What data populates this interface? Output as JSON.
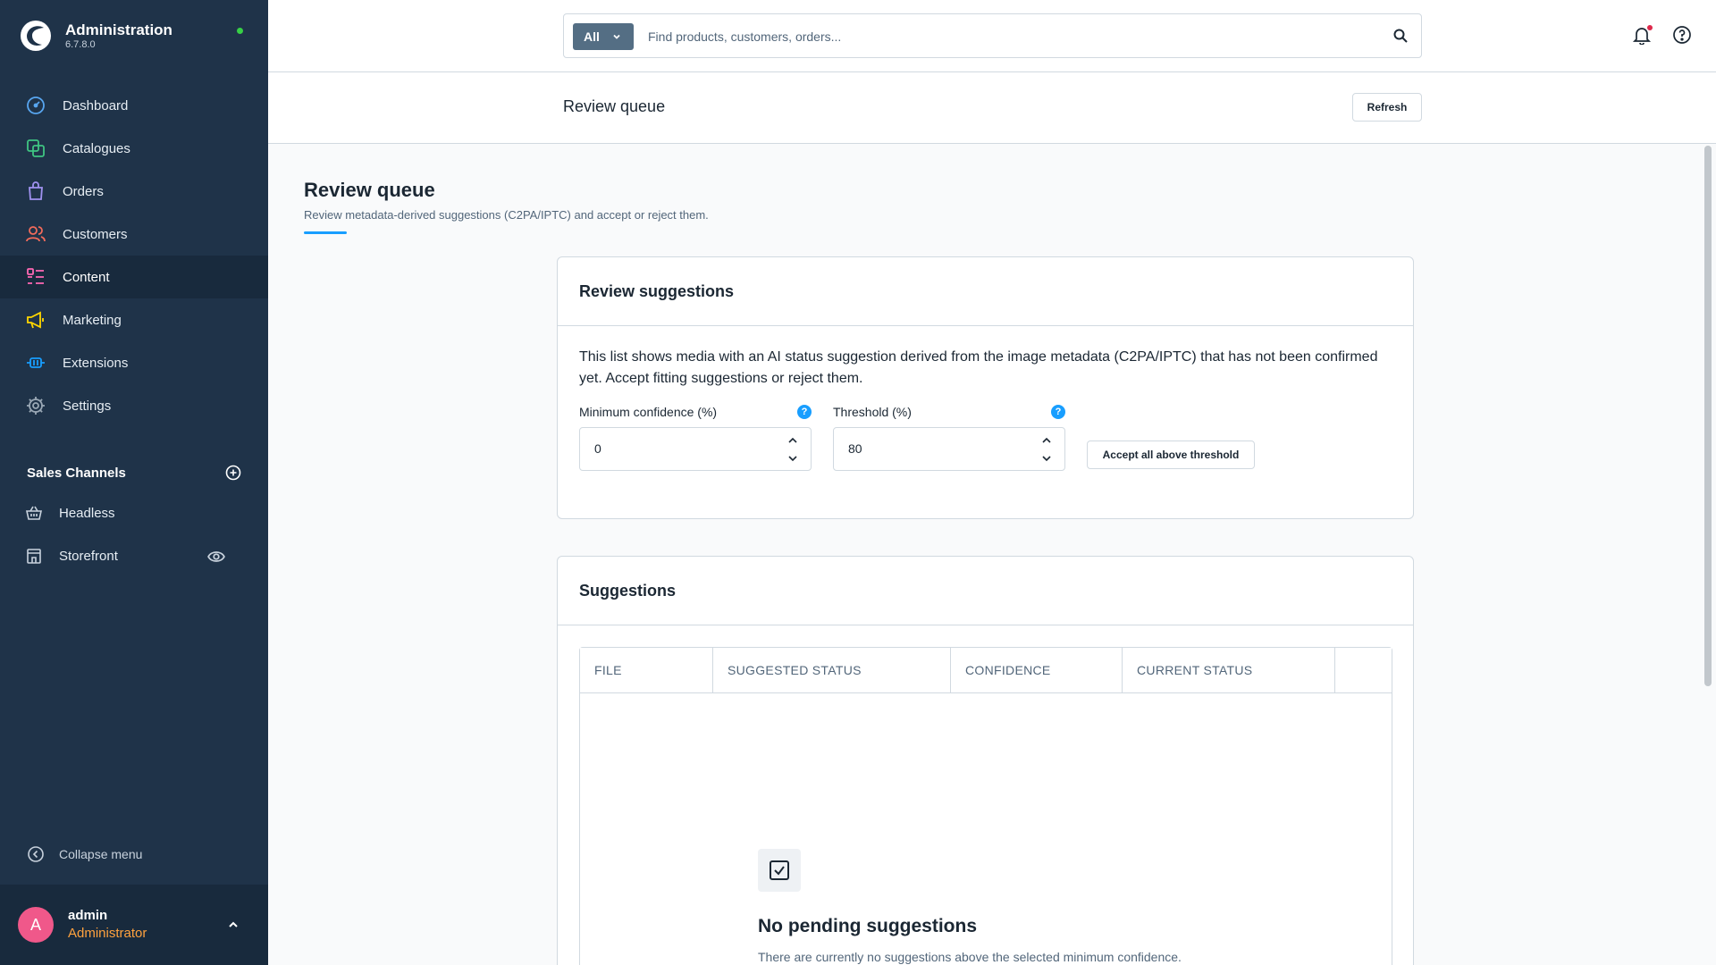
{
  "app": {
    "title": "Administration",
    "version": "6.7.8.0"
  },
  "nav": [
    {
      "label": "Dashboard",
      "icon": "dashboard-icon"
    },
    {
      "label": "Catalogues",
      "icon": "catalogues-icon"
    },
    {
      "label": "Orders",
      "icon": "orders-icon"
    },
    {
      "label": "Customers",
      "icon": "customers-icon"
    },
    {
      "label": "Content",
      "icon": "content-icon",
      "active": true
    },
    {
      "label": "Marketing",
      "icon": "marketing-icon"
    },
    {
      "label": "Extensions",
      "icon": "extensions-icon"
    },
    {
      "label": "Settings",
      "icon": "settings-icon"
    }
  ],
  "sales_channels": {
    "title": "Sales Channels",
    "items": [
      {
        "label": "Headless"
      },
      {
        "label": "Storefront"
      }
    ]
  },
  "collapse_label": "Collapse menu",
  "user": {
    "initial": "A",
    "name": "admin",
    "role": "Administrator"
  },
  "search": {
    "type": "All",
    "placeholder": "Find products, customers, orders..."
  },
  "smartbar": {
    "title": "Review queue",
    "refresh": "Refresh"
  },
  "page": {
    "title": "Review queue",
    "subtitle": "Review metadata-derived suggestions (C2PA/IPTC) and accept or reject them."
  },
  "review_card": {
    "title": "Review suggestions",
    "description": "This list shows media with an AI status suggestion derived from the image metadata (C2PA/IPTC) that has not been confirmed yet. Accept fitting suggestions or reject them.",
    "min_confidence": {
      "label": "Minimum confidence (%)",
      "value": "0"
    },
    "threshold": {
      "label": "Threshold (%)",
      "value": "80"
    },
    "accept_button": "Accept all above threshold"
  },
  "suggestions_card": {
    "title": "Suggestions",
    "columns": [
      "FILE",
      "SUGGESTED STATUS",
      "CONFIDENCE",
      "CURRENT STATUS"
    ],
    "empty_title": "No pending suggestions",
    "empty_text": "There are currently no suggestions above the selected minimum confidence."
  },
  "colors": {
    "sidebar": "#1f3349",
    "accent": "#189eff",
    "role": "#ffa23e",
    "avatar": "#f0588a"
  }
}
